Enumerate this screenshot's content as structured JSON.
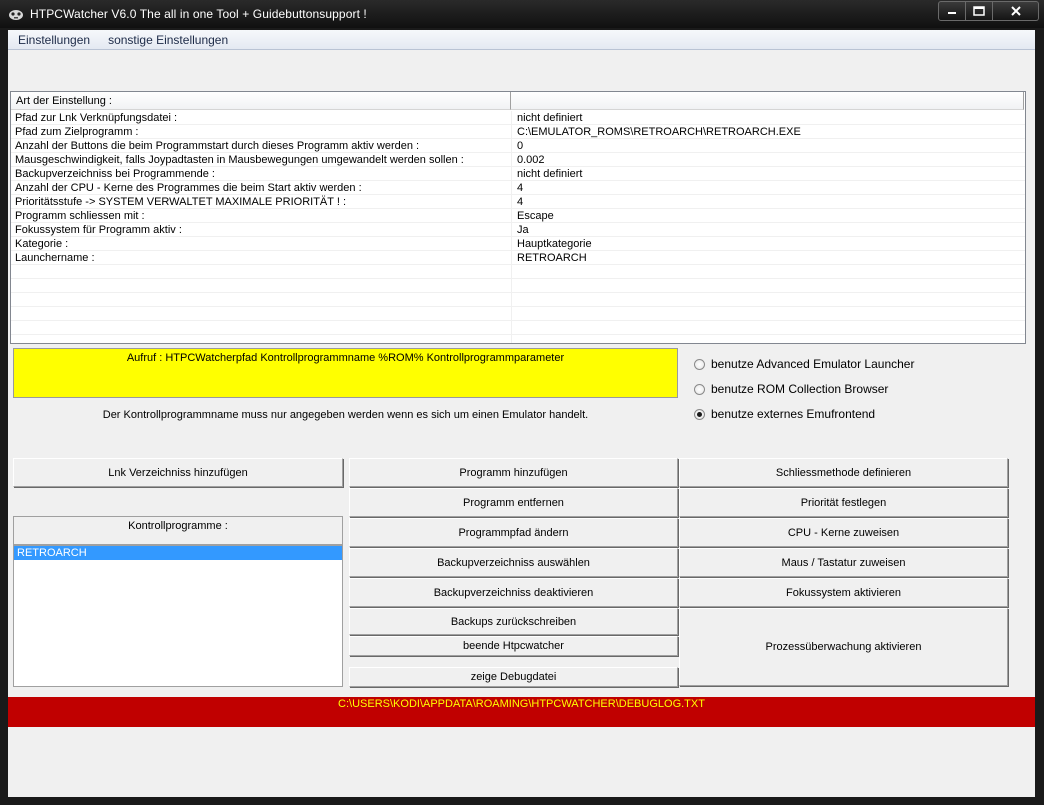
{
  "window": {
    "title": "HTPCWatcher V6.0 The all in one Tool + Guidebuttonsupport !"
  },
  "menu": {
    "items": [
      "Einstellungen",
      "sonstige Einstellungen"
    ]
  },
  "settings_grid": {
    "header": [
      "Art der Einstellung :",
      ""
    ],
    "rows": [
      {
        "key": "Pfad zur Lnk Verknüpfungsdatei :",
        "value": "nicht definiert"
      },
      {
        "key": "Pfad zum Zielprogramm :",
        "value": "C:\\EMULATOR_ROMS\\RETROARCH\\RETROARCH.EXE"
      },
      {
        "key": "Anzahl der Buttons die beim Programmstart durch dieses Programm aktiv werden :",
        "value": "0"
      },
      {
        "key": "Mausgeschwindigkeit, falls Joypadtasten in Mausbewegungen umgewandelt werden sollen  :",
        "value": "0.002"
      },
      {
        "key": "Backupverzeichniss bei Programmende :",
        "value": "nicht definiert"
      },
      {
        "key": "Anzahl der CPU - Kerne des Programmes die beim Start aktiv werden :",
        "value": "4"
      },
      {
        "key": "Prioritätsstufe -> SYSTEM VERWALTET MAXIMALE PRIORITÄT ! :",
        "value": "4"
      },
      {
        "key": "Programm schliessen mit :",
        "value": "Escape"
      },
      {
        "key": "Fokussystem für Programm aktiv :",
        "value": "Ja"
      },
      {
        "key": "Kategorie :",
        "value": "Hauptkategorie"
      },
      {
        "key": "Launchername :",
        "value": "RETROARCH"
      }
    ]
  },
  "call_info": "Aufruf : HTPCWatcherpfad Kontrollprogrammname %ROM% Kontrollprogrammparameter",
  "hint": "Der Kontrollprogrammname muss nur angegeben werden wenn es sich um einen Emulator handelt.",
  "radio_options": [
    {
      "label": "benutze Advanced Emulator Launcher",
      "checked": false
    },
    {
      "label": "benutze ROM Collection Browser",
      "checked": false
    },
    {
      "label": "benutze externes Emufrontend",
      "checked": true
    }
  ],
  "buttons": {
    "lnk_add": "Lnk Verzeichniss hinzufügen",
    "prog_add": "Programm hinzufügen",
    "prog_remove": "Programm entfernen",
    "prog_path": "Programmpfad ändern",
    "backup_select": "Backupverzeichniss auswählen",
    "backup_disable": "Backupverzeichniss deaktivieren",
    "backup_restore": "Backups zurückschreiben",
    "quit": "beende Htpcwatcher",
    "debug": "zeige Debugdatei",
    "close_method": "Schliessmethode definieren",
    "priority": "Priorität festlegen",
    "cpu": "CPU - Kerne zuweisen",
    "mouse_kb": "Maus / Tastatur zuweisen",
    "focus": "Fokussystem aktivieren",
    "process_watch": "Prozessüberwachung aktivieren"
  },
  "control_programs": {
    "label": "Kontrollprogramme :",
    "items": [
      "RETROARCH"
    ],
    "selected": "RETROARCH"
  },
  "status": {
    "debug_path": "C:\\USERS\\KODI\\APPDATA\\ROAMING\\HTPCWATCHER\\DEBUGLOG.TXT"
  },
  "colors": {
    "info_box": "#ffff00",
    "status_bar": "#c00000",
    "status_text": "#ffff00",
    "selection": "#3399ff"
  }
}
